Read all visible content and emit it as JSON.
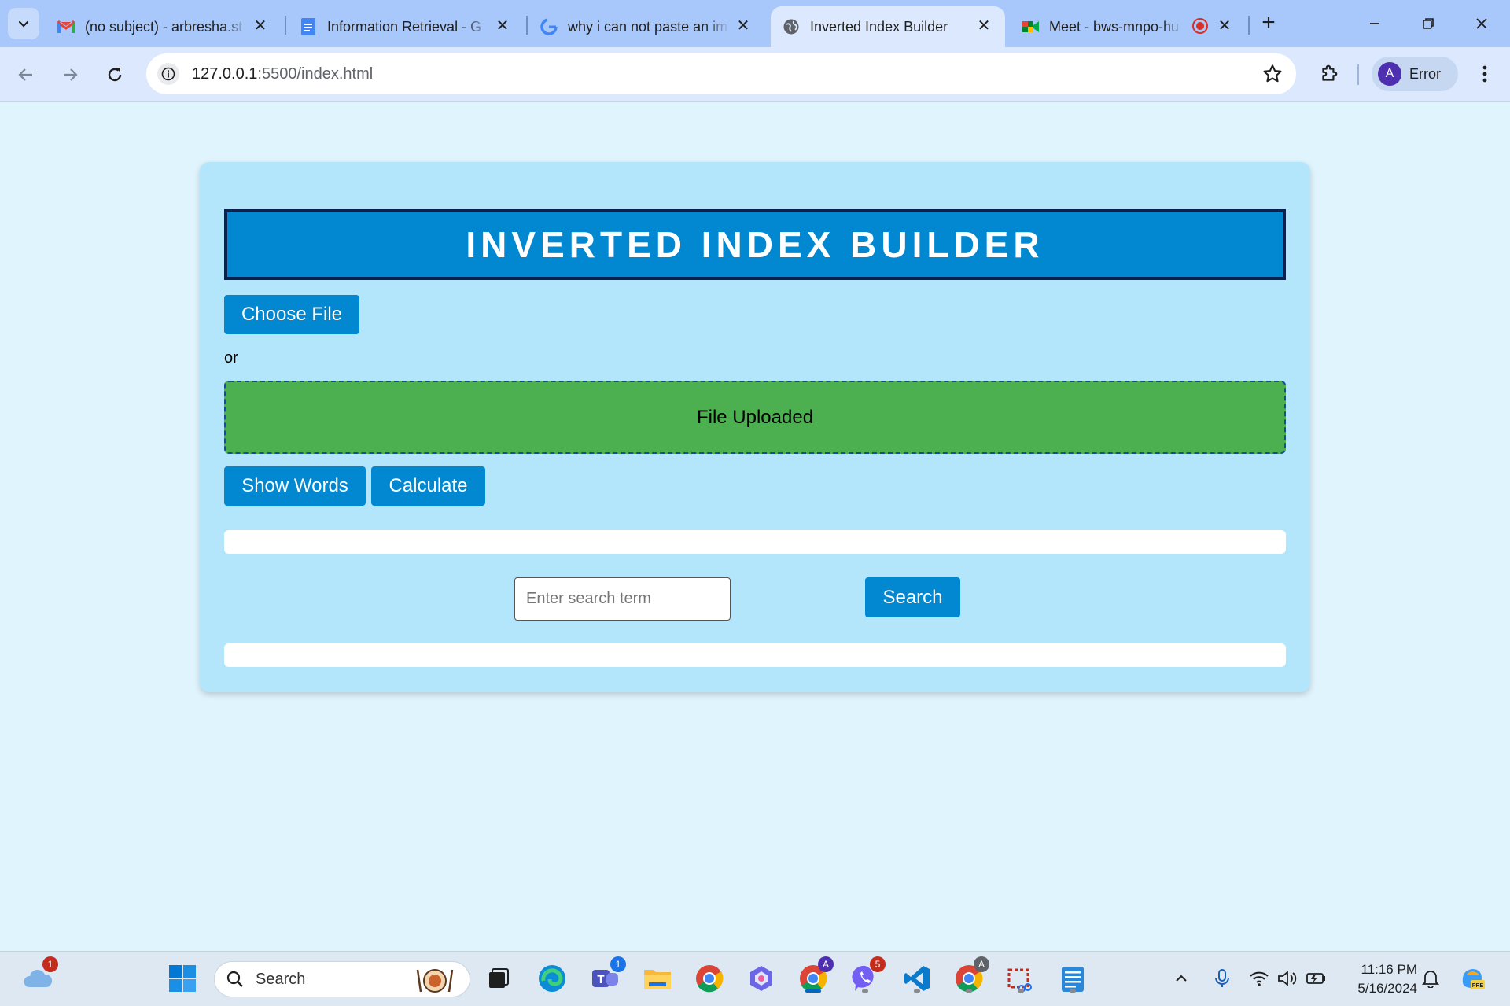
{
  "browser": {
    "tabs": [
      {
        "title": "(no subject) - arbresha.st",
        "favicon": "gmail-icon",
        "active": false
      },
      {
        "title": "Information Retrieval - G",
        "favicon": "google-docs-icon",
        "active": false
      },
      {
        "title": "why i can not paste an im",
        "favicon": "google-icon",
        "active": false
      },
      {
        "title": "Inverted Index Builder",
        "favicon": "globe-icon",
        "active": true
      },
      {
        "title": "Meet - bws-mnpo-hu",
        "favicon": "google-meet-icon",
        "active": false
      }
    ],
    "url_host": "127.0.0.1",
    "url_path": ":5500/index.html",
    "profile_initial": "A",
    "profile_label": "Error"
  },
  "page": {
    "title": "INVERTED INDEX BUILDER",
    "choose_file_label": "Choose File",
    "or_text": "or",
    "dropzone_text": "File Uploaded",
    "show_words_label": "Show Words",
    "calculate_label": "Calculate",
    "search_placeholder": "Enter search term",
    "search_label": "Search",
    "colors": {
      "background": "#e0f4fd",
      "card": "#b3e5fb",
      "primary": "#0288d1",
      "dropzone": "#4caf50"
    }
  },
  "taskbar": {
    "weather_badge": "1",
    "search_label": "Search",
    "teams_badge": "1",
    "viber_badge": "5",
    "chrome_profile_badge": "A",
    "time": "11:16 PM",
    "date": "5/16/2024"
  }
}
